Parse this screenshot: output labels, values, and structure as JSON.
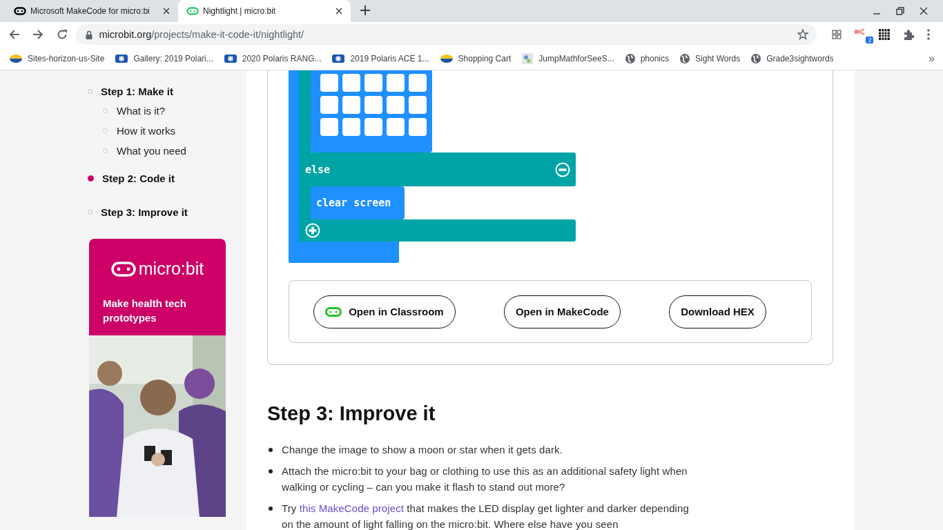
{
  "browser": {
    "tabs": [
      {
        "title": "Microsoft MakeCode for micro:bi",
        "selected": false
      },
      {
        "title": "Nightlight | micro:bit",
        "selected": true
      }
    ],
    "address": {
      "host": "microbit.org",
      "path": "/projects/make-it-code-it/nightlight/"
    },
    "extension_badge": "2",
    "bookmarks": [
      {
        "label": "Sites-horizon-us-Site",
        "kind": "disc"
      },
      {
        "label": "Gallery: 2019 Polari...",
        "kind": "badge"
      },
      {
        "label": "2020 Polaris RANG...",
        "kind": "badge"
      },
      {
        "label": "2019 Polaris ACE 1...",
        "kind": "badge"
      },
      {
        "label": "Shopping Cart",
        "kind": "disc"
      },
      {
        "label": "JumpMathforSeeS...",
        "kind": "app"
      },
      {
        "label": "phonics",
        "kind": "globe"
      },
      {
        "label": "Sight Words",
        "kind": "globe"
      },
      {
        "label": "Grade3sightwords",
        "kind": "globe"
      }
    ],
    "more": "»"
  },
  "sidebar": {
    "steps": [
      {
        "label": "Step 1: Make it",
        "selected": false,
        "children": [
          {
            "label": "What is it?"
          },
          {
            "label": "How it works"
          },
          {
            "label": "What you need"
          }
        ]
      },
      {
        "label": "Step 2: Code it",
        "selected": true
      },
      {
        "label": "Step 3: Improve it",
        "selected": false
      }
    ],
    "promo": {
      "logo": "micro:bit",
      "text": "Make health tech prototypes"
    }
  },
  "code": {
    "blocks": {
      "else": "else",
      "action": "clear screen"
    },
    "buttons": [
      {
        "label": "Open in Classroom",
        "icon": true
      },
      {
        "label": "Open in MakeCode",
        "icon": false
      },
      {
        "label": "Download HEX",
        "icon": false
      }
    ]
  },
  "improve": {
    "heading": "Step 3: Improve it",
    "items": [
      {
        "text": "Change the image to show a moon or star when it gets dark."
      },
      {
        "text": "Attach the micro:bit to your bag or clothing to use this as an additional safety light when walking or cycling – can you make it flash to stand out more?"
      },
      {
        "text": "Try ",
        "link": "this MakeCode project",
        "after": " that makes the LED display get lighter and darker depending on the amount of light falling on the micro:bit. Where else have you seen"
      }
    ]
  }
}
